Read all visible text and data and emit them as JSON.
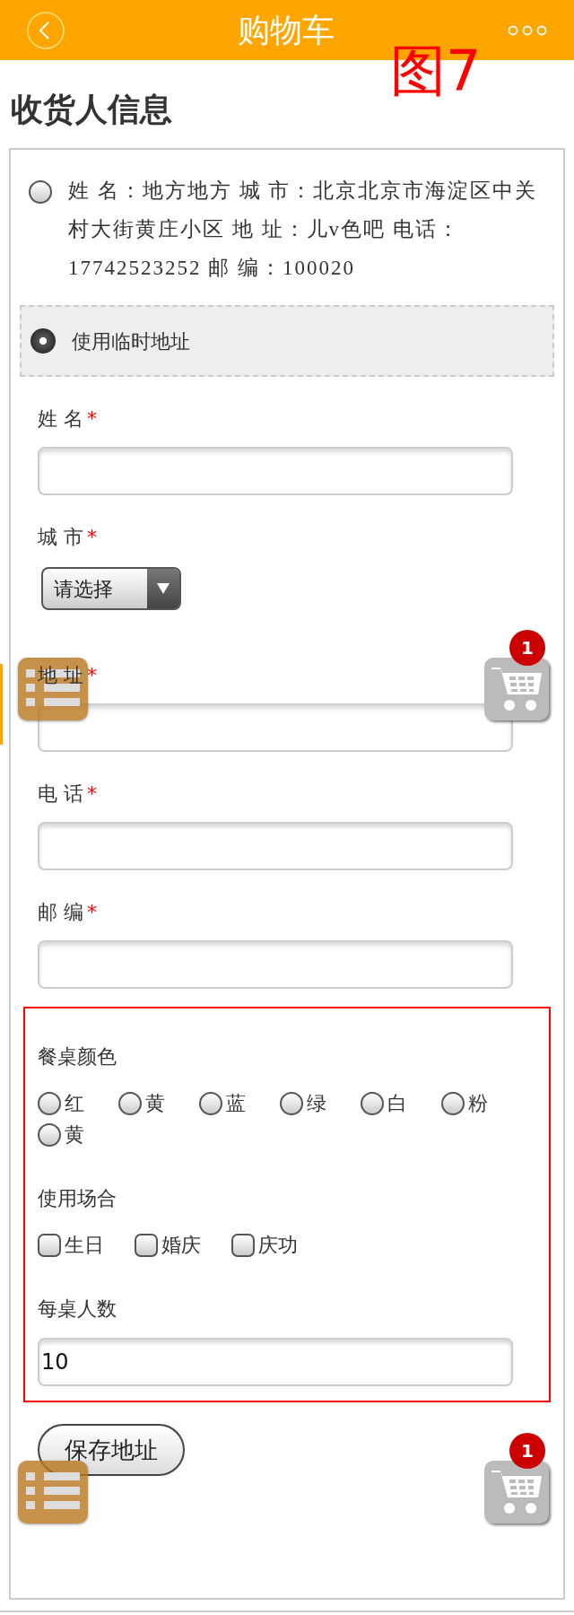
{
  "header": {
    "title": "购物车"
  },
  "figure_label": "图7",
  "section_title": "收货人信息",
  "addresses": [
    {
      "text": "姓 名：地方地方 城 市：北京北京市海淀区中关村大街黄庄小区  地 址：儿v色吧 电话：17742523252 邮 编：100020",
      "selected": false
    },
    {
      "text": "使用临时地址",
      "selected": true
    }
  ],
  "fields": [
    {
      "kind": "text",
      "label": "姓 名",
      "mark": "*"
    },
    {
      "kind": "select",
      "label": "城 市",
      "mark": "*",
      "value": "请选择"
    },
    {
      "kind": "text",
      "label": "地 址",
      "mark": "*"
    },
    {
      "kind": "text",
      "label": "电 话",
      "mark": "*"
    },
    {
      "kind": "text",
      "label": "邮 编",
      "mark": "*"
    }
  ],
  "options_groups": [
    {
      "kind": "radio",
      "label": "餐桌颜色",
      "options": [
        {
          "label": "红",
          "selected": false
        },
        {
          "label": "黄",
          "selected": false
        },
        {
          "label": "蓝",
          "selected": false
        },
        {
          "label": "绿",
          "selected": false
        },
        {
          "label": "白",
          "selected": false
        },
        {
          "label": "粉",
          "selected": false
        },
        {
          "label": "黄",
          "selected": false
        }
      ]
    },
    {
      "kind": "checkbox",
      "label": "使用场合",
      "options": [
        {
          "label": "生日",
          "checked": false
        },
        {
          "label": "婚庆",
          "checked": false
        },
        {
          "label": "庆功",
          "checked": false
        }
      ]
    },
    {
      "kind": "text",
      "label": "每桌人数",
      "value": "10"
    }
  ],
  "save_button": "保存地址",
  "floating_buttons": [
    {
      "cart_badge": "1"
    },
    {
      "cart_badge": "1"
    }
  ]
}
